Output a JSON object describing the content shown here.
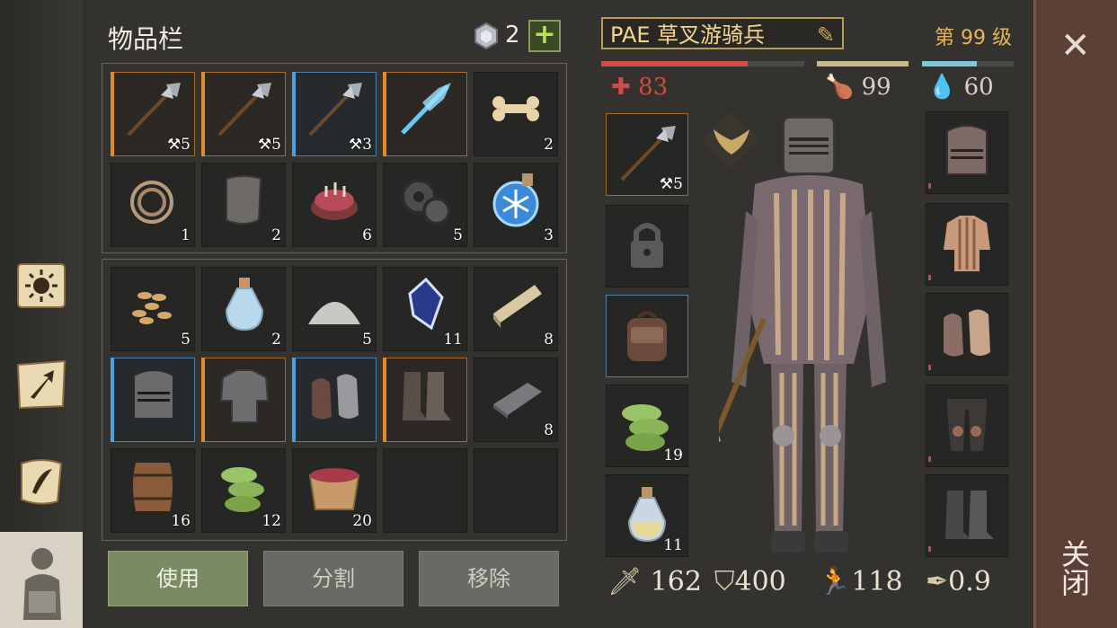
{
  "inventory": {
    "title": "物品栏",
    "gem_count": "2",
    "plus_label": "+",
    "slots_top": [
      {
        "name": "halberd",
        "count": "5",
        "border": "orange",
        "prefix": "⚒"
      },
      {
        "name": "halberd",
        "count": "5",
        "border": "orange",
        "prefix": "⚒"
      },
      {
        "name": "halberd",
        "count": "3",
        "border": "blue",
        "prefix": "⚒"
      },
      {
        "name": "ice-spear",
        "count": "",
        "border": "orange",
        "prefix": ""
      },
      {
        "name": "bone",
        "count": "2",
        "border": "none",
        "prefix": ""
      },
      {
        "name": "rope",
        "count": "1",
        "border": "none",
        "prefix": ""
      },
      {
        "name": "leather-scrap",
        "count": "2",
        "border": "none",
        "prefix": ""
      },
      {
        "name": "meat-bowl",
        "count": "6",
        "border": "none",
        "prefix": ""
      },
      {
        "name": "gears",
        "count": "5",
        "border": "none",
        "prefix": ""
      },
      {
        "name": "frost-potion",
        "count": "3",
        "border": "none",
        "prefix": ""
      }
    ],
    "slots_bottom": [
      {
        "name": "seeds",
        "count": "5",
        "border": "none"
      },
      {
        "name": "water-flask",
        "count": "2",
        "border": "none"
      },
      {
        "name": "salt-pile",
        "count": "5",
        "border": "none"
      },
      {
        "name": "crystal",
        "count": "11",
        "border": "none"
      },
      {
        "name": "planks",
        "count": "8",
        "border": "none"
      },
      {
        "name": "helmet",
        "count": "",
        "border": "blue"
      },
      {
        "name": "chainmail",
        "count": "",
        "border": "orange"
      },
      {
        "name": "gauntlets",
        "count": "",
        "border": "blue"
      },
      {
        "name": "boots",
        "count": "",
        "border": "orange"
      },
      {
        "name": "iron-ingot",
        "count": "8",
        "border": "none"
      },
      {
        "name": "barrel",
        "count": "16",
        "border": "none"
      },
      {
        "name": "herbs",
        "count": "12",
        "border": "none"
      },
      {
        "name": "berry-bucket",
        "count": "20",
        "border": "none"
      },
      {
        "name": "empty",
        "count": "",
        "border": "none"
      },
      {
        "name": "empty",
        "count": "",
        "border": "none"
      }
    ],
    "buttons": {
      "use": "使用",
      "split": "分割",
      "remove": "移除"
    }
  },
  "character": {
    "name": "PAE 草叉游骑兵",
    "level": "第 99 级",
    "health": "83",
    "food": "99",
    "water": "60",
    "health_fraction": 0.72,
    "food_fraction": 1.0,
    "water_fraction": 0.6,
    "weapon_count": "5",
    "herbs_count": "19",
    "flask_count": "11",
    "attack": "162",
    "armor": "400",
    "speed": "118",
    "weight": "0.9"
  },
  "close": {
    "x": "✕",
    "label": "关闭"
  },
  "colors": {
    "health": "#d24a44",
    "food": "#c9b88a",
    "water": "#7fc7d8",
    "orange_rarity": "#e08b2a",
    "blue_rarity": "#4aa0e0"
  }
}
